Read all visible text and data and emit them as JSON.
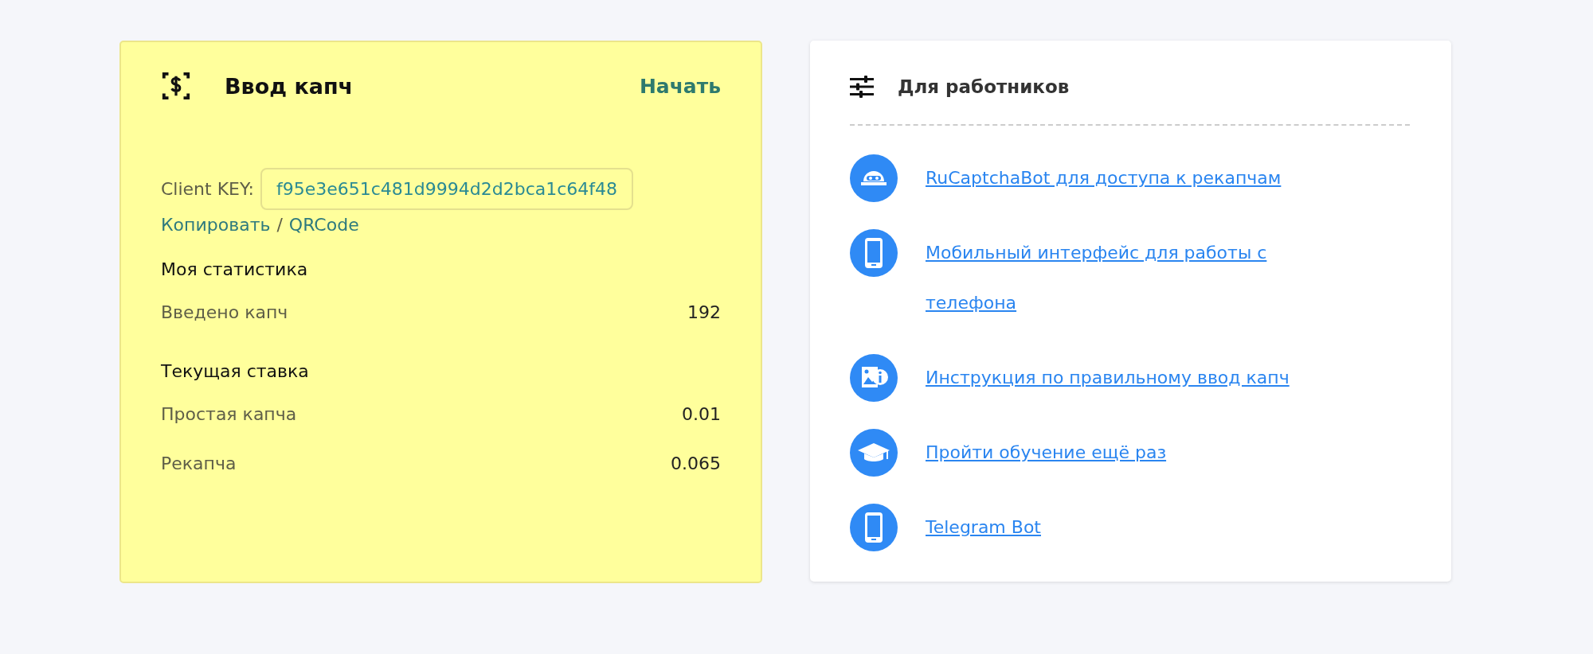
{
  "captcha_card": {
    "title": "Ввод капч",
    "start_link": "Начать",
    "client_key_label": "Client KEY:",
    "client_key_value": "f95e3e651c481d9994d2d2bca1c64f48",
    "copy_link": "Копировать",
    "separator": "/",
    "qr_link": "QRCode",
    "sections": [
      {
        "heading": "Моя статистика",
        "rows": [
          {
            "label": "Введено капч",
            "value": "192"
          }
        ]
      },
      {
        "heading": "Текущая ставка",
        "rows": [
          {
            "label": "Простая капча",
            "value": "0.01"
          },
          {
            "label": "Рекапча",
            "value": "0.065"
          }
        ]
      }
    ]
  },
  "workers_card": {
    "title": "Для работников",
    "links": [
      {
        "kind": "robot",
        "label": "RuCaptchaBot для доступа к рекапчам"
      },
      {
        "kind": "phone",
        "label": "Мобильный интерфейс для работы с телефона"
      },
      {
        "kind": "info",
        "label": "Инструкция по правильному ввод капч"
      },
      {
        "kind": "cap",
        "label": "Пройти обучение ещё раз"
      },
      {
        "kind": "phone",
        "label": "Telegram Bot"
      }
    ]
  }
}
